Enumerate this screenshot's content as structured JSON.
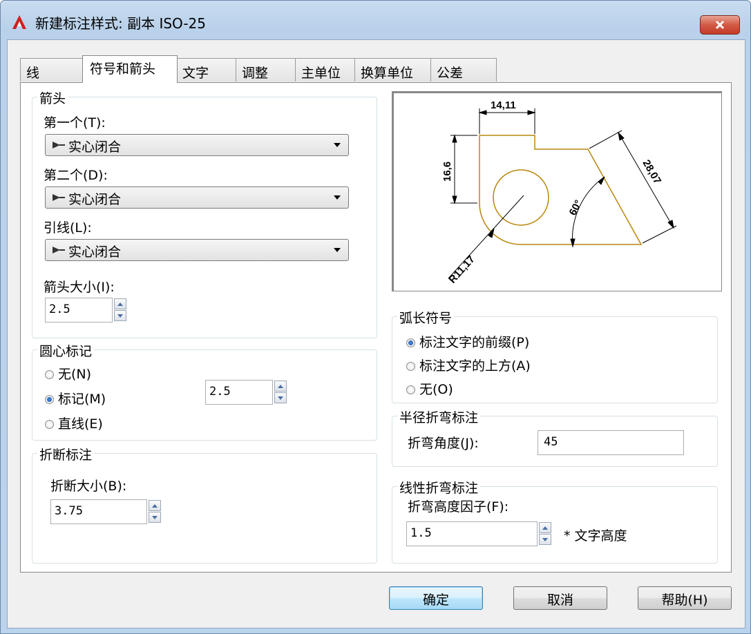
{
  "window": {
    "title": "新建标注样式: 副本 ISO-25"
  },
  "tabs": [
    {
      "label": "线"
    },
    {
      "label": "符号和箭头"
    },
    {
      "label": "文字"
    },
    {
      "label": "调整"
    },
    {
      "label": "主单位"
    },
    {
      "label": "换算单位"
    },
    {
      "label": "公差"
    }
  ],
  "arrowheads": {
    "legend": "箭头",
    "first_label": "第一个(T):",
    "first_value": "实心闭合",
    "second_label": "第二个(D):",
    "second_value": "实心闭合",
    "leader_label": "引线(L):",
    "leader_value": "实心闭合",
    "size_label": "箭头大小(I):",
    "size_value": "2.5"
  },
  "center_marks": {
    "legend": "圆心标记",
    "options": [
      {
        "label": "无(N)",
        "selected": false
      },
      {
        "label": "标记(M)",
        "selected": true
      },
      {
        "label": "直线(E)",
        "selected": false
      }
    ],
    "size_value": "2.5"
  },
  "dimension_break": {
    "legend": "折断标注",
    "size_label": "折断大小(B):",
    "size_value": "3.75"
  },
  "preview": {
    "dims": [
      "14,11",
      "16,6",
      "28,07",
      "60°",
      "R11,17"
    ]
  },
  "arc_length_symbol": {
    "legend": "弧长符号",
    "options": [
      {
        "label": "标注文字的前缀(P)",
        "selected": true
      },
      {
        "label": "标注文字的上方(A)",
        "selected": false
      },
      {
        "label": "无(O)",
        "selected": false
      }
    ]
  },
  "radius_jog": {
    "legend": "半径折弯标注",
    "angle_label": "折弯角度(J):",
    "angle_value": "45"
  },
  "linear_jog": {
    "legend": "线性折弯标注",
    "height_label": "折弯高度因子(F):",
    "height_value": "1.5",
    "suffix": "* 文字高度"
  },
  "buttons": {
    "ok": "确定",
    "cancel": "取消",
    "help": "帮助(H)"
  },
  "colors": {
    "accent": "#3c7fb1",
    "shape_stroke": "#b8860b",
    "title_bar": "#bcd3ec"
  }
}
